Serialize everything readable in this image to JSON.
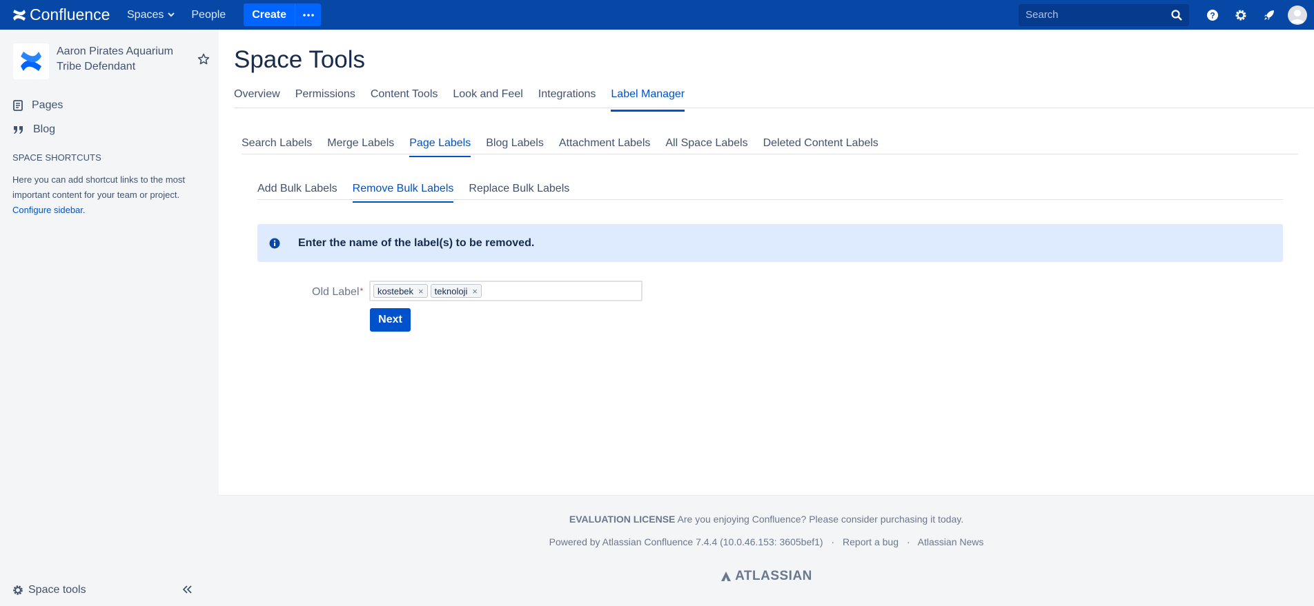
{
  "brand": {
    "name": "Confluence",
    "primary": "#0747a6",
    "accent": "#0052cc",
    "info_bg": "#deebff"
  },
  "topnav": {
    "spaces_label": "Spaces",
    "people_label": "People",
    "create_label": "Create",
    "search_placeholder": "Search",
    "icons": [
      "help-icon",
      "gear-icon",
      "rocket-icon",
      "avatar"
    ]
  },
  "sidebar": {
    "space_name": "Aaron Pirates Aquarium Tribe Defendant",
    "items": [
      {
        "label": "Pages",
        "icon": "pages-icon"
      },
      {
        "label": "Blog",
        "icon": "quote-icon"
      }
    ],
    "shortcuts_title": "SPACE SHORTCUTS",
    "shortcuts_text": "Here you can add shortcut links to the most important content for your team or project.",
    "configure_link": "Configure sidebar.",
    "space_tools_label": "Space tools"
  },
  "main": {
    "title": "Space Tools",
    "tabs": [
      {
        "label": "Overview"
      },
      {
        "label": "Permissions"
      },
      {
        "label": "Content Tools"
      },
      {
        "label": "Look and Feel"
      },
      {
        "label": "Integrations"
      },
      {
        "label": "Label Manager",
        "active": true
      }
    ],
    "subtabs": [
      {
        "label": "Search Labels"
      },
      {
        "label": "Merge Labels"
      },
      {
        "label": "Page Labels",
        "active": true
      },
      {
        "label": "Blog Labels"
      },
      {
        "label": "Attachment Labels"
      },
      {
        "label": "All Space Labels"
      },
      {
        "label": "Deleted Content Labels"
      }
    ],
    "bulk_tabs": [
      {
        "label": "Add Bulk Labels"
      },
      {
        "label": "Remove Bulk Labels",
        "active": true
      },
      {
        "label": "Replace Bulk Labels"
      }
    ],
    "info_message": "Enter the name of the label(s) to be removed.",
    "field_label": "Old Label",
    "required_mark": "*",
    "chips": [
      "kostebek",
      "teknoloji"
    ],
    "chip_remove": "×",
    "next_label": "Next"
  },
  "footer": {
    "license_bold": "EVALUATION LICENSE",
    "license_text": "Are you enjoying Confluence? Please consider purchasing it today.",
    "powered": "Powered by Atlassian Confluence 7.4.4 (10.0.46.153: 3605bef1)",
    "sep": "·",
    "report_bug": "Report a bug",
    "news": "Atlassian News",
    "atlassian": "ATLASSIAN"
  }
}
